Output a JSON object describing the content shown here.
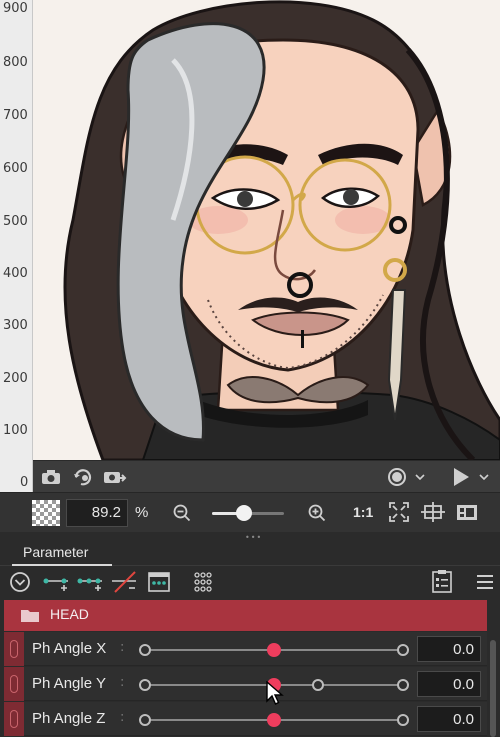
{
  "ruler": {
    "labels": [
      "900",
      "800",
      "700",
      "600",
      "500",
      "400",
      "300",
      "200",
      "100",
      "0"
    ]
  },
  "canvas_toolbar": {
    "icons": [
      "camera-icon",
      "camera-rotate-icon",
      "camera-export-icon",
      "record-icon",
      "chevron-down-icon",
      "play-icon",
      "chevron-down-icon"
    ]
  },
  "view_toolbar": {
    "zoom_value": "89.2",
    "zoom_unit": "%",
    "zoom_slider_fraction": 0.45,
    "ratio_label": "1:1"
  },
  "panel": {
    "tab_label": "Parameter",
    "group": {
      "label": "HEAD",
      "color": "#a9343f"
    },
    "params": [
      {
        "name": "Ph Angle X",
        "value": "0.0",
        "knob": 0.5,
        "mid_marker": null
      },
      {
        "name": "Ph Angle Y",
        "value": "0.0",
        "knob": 0.5,
        "mid_marker": 0.67
      },
      {
        "name": "Ph Angle Z",
        "value": "0.0",
        "knob": 0.5,
        "mid_marker": null
      }
    ]
  },
  "colors": {
    "accent_knob": "#ee3d5d",
    "group_header": "#a9343f",
    "param_stripe": "#7e2b33"
  }
}
